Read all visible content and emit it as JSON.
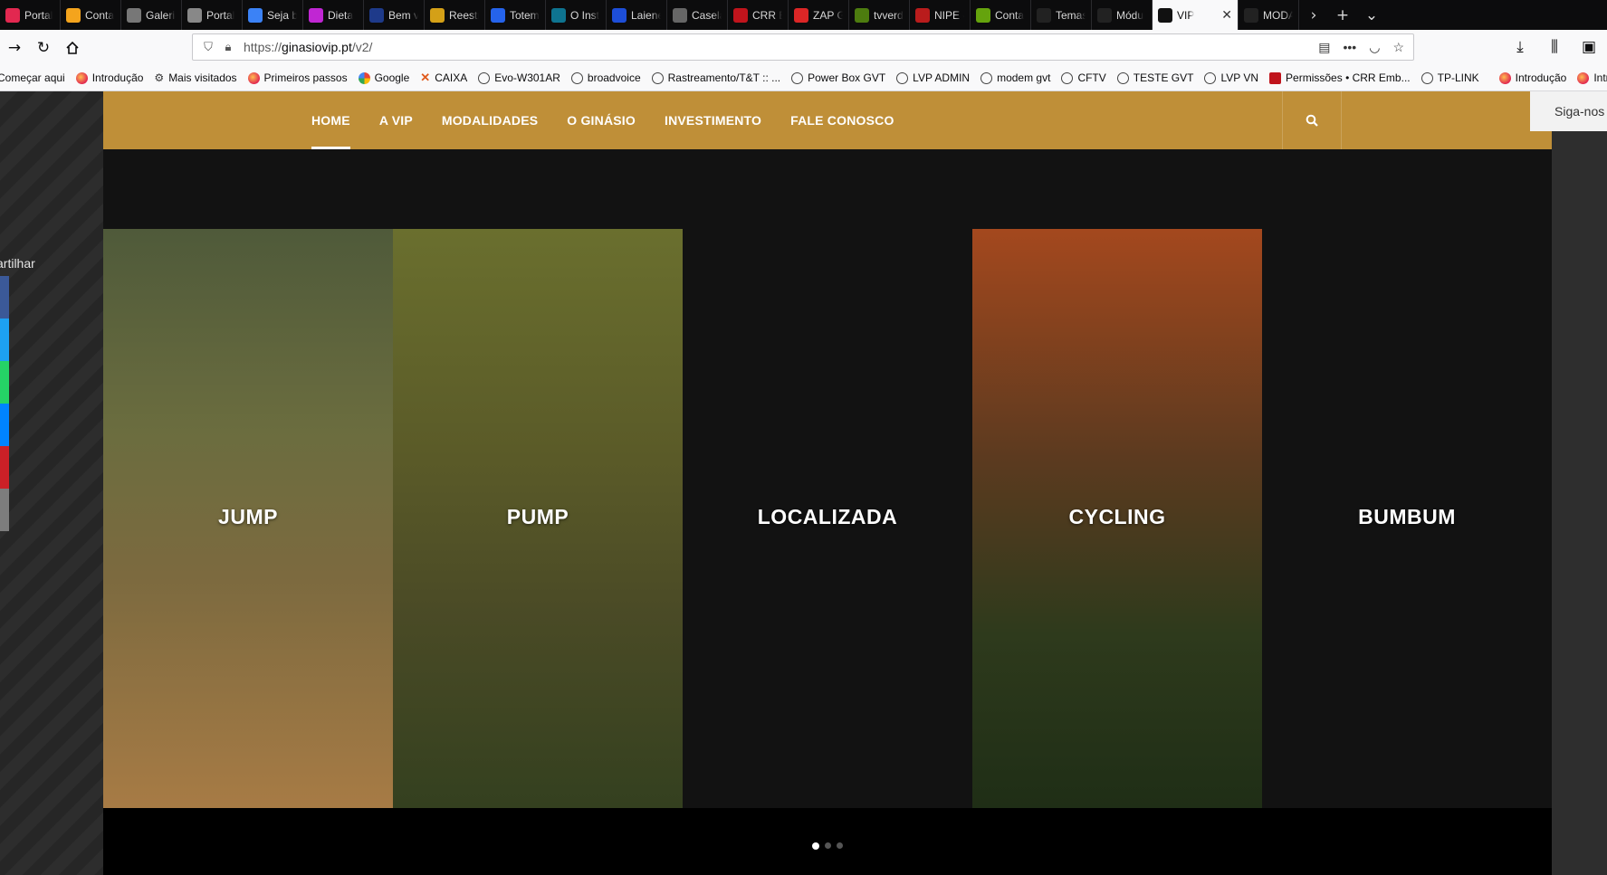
{
  "browser": {
    "tabs": [
      {
        "label": "Portal",
        "icon": "portal-icon",
        "color": "#e22850"
      },
      {
        "label": "Conta",
        "icon": "joomla-icon",
        "color": "#f4a41d"
      },
      {
        "label": "Galeria",
        "icon": "gallery-icon",
        "color": "#777777"
      },
      {
        "label": "Portal",
        "icon": "portal-z-icon",
        "color": "#888888"
      },
      {
        "label": "Seja bem",
        "icon": "colorful-icon",
        "color": "#3b82f6"
      },
      {
        "label": "Dieta",
        "icon": "diet-icon",
        "color": "#c026d3"
      },
      {
        "label": "Bem v",
        "icon": "circle-blue-icon",
        "color": "#1e3a8a"
      },
      {
        "label": "Reestr",
        "icon": "t-icon",
        "color": "#d4a017"
      },
      {
        "label": "Totem",
        "icon": "totem-icon",
        "color": "#2563eb"
      },
      {
        "label": "O Inst",
        "icon": "inst-icon",
        "color": "#0e7490"
      },
      {
        "label": "Laiene",
        "icon": "laiene-icon",
        "color": "#1d4ed8"
      },
      {
        "label": "Casela",
        "icon": "casela-icon",
        "color": "#666666"
      },
      {
        "label": "CRR E",
        "icon": "crr-icon",
        "color": "#c0141c"
      },
      {
        "label": "ZAP G",
        "icon": "zap-icon",
        "color": "#dc2626"
      },
      {
        "label": "tvverd",
        "icon": "w-icon",
        "color": "#4d7c0f"
      },
      {
        "label": "NIPE -",
        "icon": "nipe-icon",
        "color": "#b91c1c"
      },
      {
        "label": "Conta",
        "icon": "globe-green-icon",
        "color": "#65a30d"
      },
      {
        "label": "Temas",
        "icon": "vip-icon",
        "color": "#222222"
      },
      {
        "label": "Módu",
        "icon": "vip-icon",
        "color": "#222222"
      }
    ],
    "active_tab": {
      "label": "VIP",
      "icon": "vip-icon",
      "color": "#111111"
    },
    "after_tabs": [
      {
        "label": "MODA",
        "icon": "vip-icon",
        "color": "#222222"
      }
    ],
    "url_prefix": "https://",
    "url_host": "ginasiovip.pt",
    "url_path": "/v2/",
    "bookmarks": [
      {
        "label": "Começar aqui",
        "icon": "none"
      },
      {
        "label": "Introdução",
        "icon": "fx"
      },
      {
        "label": "Mais visitados",
        "icon": "gear"
      },
      {
        "label": "Primeiros passos",
        "icon": "fx"
      },
      {
        "label": "Google",
        "icon": "g"
      },
      {
        "label": "CAIXA",
        "icon": "x"
      },
      {
        "label": "Evo-W301AR",
        "icon": "globe"
      },
      {
        "label": "broadvoice",
        "icon": "globe"
      },
      {
        "label": "Rastreamento/T&T :: ...",
        "icon": "globe"
      },
      {
        "label": "Power Box GVT",
        "icon": "globe"
      },
      {
        "label": "LVP ADMIN",
        "icon": "globe"
      },
      {
        "label": "modem gvt",
        "icon": "globe"
      },
      {
        "label": "CFTV",
        "icon": "globe"
      },
      {
        "label": "TESTE GVT",
        "icon": "globe"
      },
      {
        "label": "LVP VN",
        "icon": "globe"
      },
      {
        "label": "Permissões • CRR Emb...",
        "icon": "crr"
      },
      {
        "label": "TP-LINK",
        "icon": "globe"
      },
      {
        "label": "Introdução",
        "icon": "fx"
      },
      {
        "label": "Intro",
        "icon": "fx"
      }
    ]
  },
  "site": {
    "menu": [
      "HOME",
      "A VIP",
      "MODALIDADES",
      "O GINÁSIO",
      "INVESTIMENTO",
      "FALE CONOSCO"
    ],
    "active_menu": "HOME",
    "follow_label": "Siga-nos",
    "share_label": "artilhar",
    "share_colors": [
      "#3b5998",
      "#1da1f2",
      "#25d366",
      "#0084ff",
      "#cb2027",
      "#7d7d7d"
    ],
    "colors": {
      "nav": "#bf8f38",
      "background": "#121212"
    },
    "cards": [
      {
        "title": "JUMP",
        "style": "c-jump"
      },
      {
        "title": "PUMP",
        "style": "c-pump"
      },
      {
        "title": "LOCALIZADA",
        "style": "c-loc"
      },
      {
        "title": "CYCLING",
        "style": "c-cyc"
      },
      {
        "title": "BUMBUM",
        "style": "c-bum"
      }
    ],
    "pager": {
      "count": 3,
      "active": 1
    }
  }
}
